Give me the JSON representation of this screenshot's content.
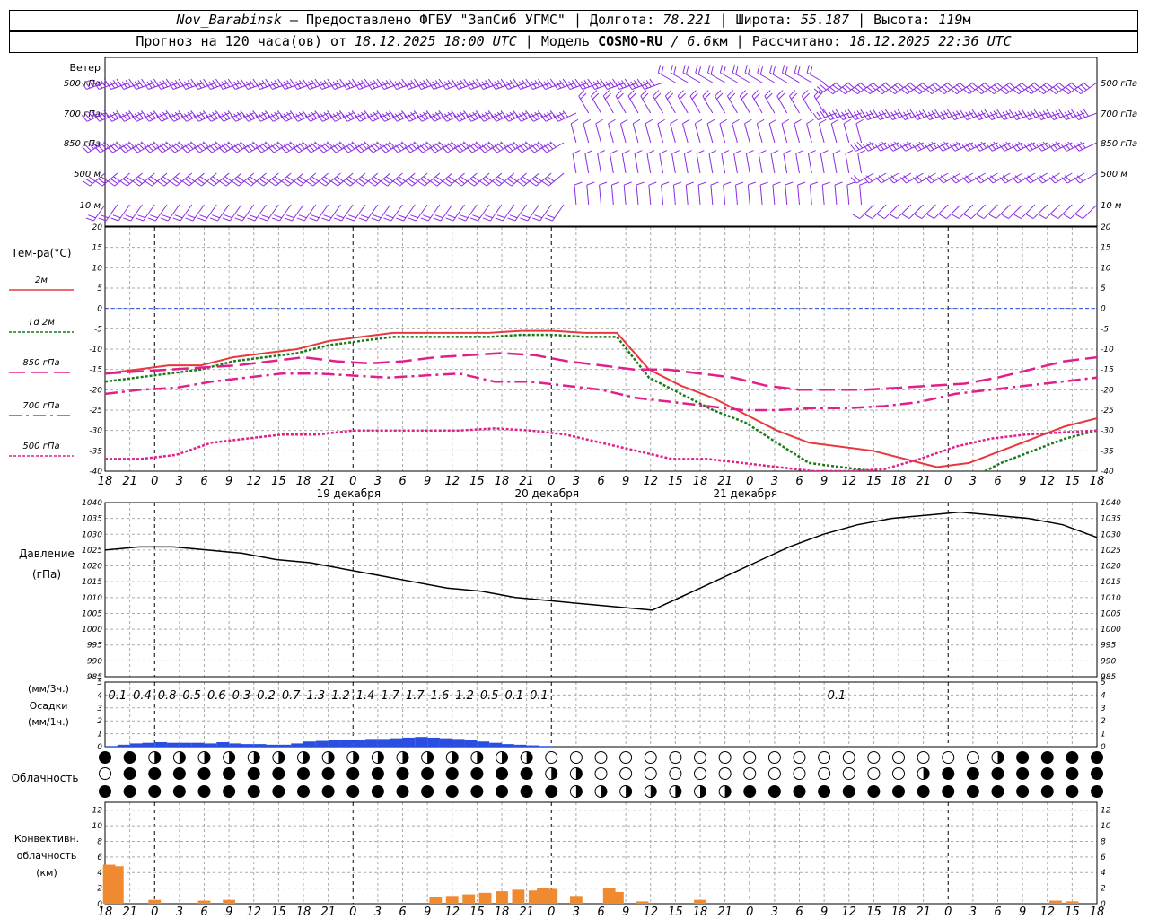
{
  "header": {
    "station": "Nov_Barabinsk",
    "provider": "— Предоставлено ФГБУ \"ЗапСиб УГМС\"",
    "lon_label": "Долгота:",
    "lon": "78.221",
    "lat_label": "Широта:",
    "lat": "55.187",
    "alt_label": "Высота:",
    "alt": "119",
    "alt_unit": "м",
    "forecast_label": "Прогноз на 120 часа(ов) от",
    "start_time": "18.12.2025 18:00 UTC",
    "model_label": "Модель",
    "model": "COSMO-RU",
    "model_res": "/ 6.6",
    "model_res_unit": "км",
    "calc_label": "Рассчитано:",
    "calc_time": "18.12.2025 22:36 UTC"
  },
  "chart_data": {
    "type": "line",
    "x_hours": [
      0,
      3,
      6,
      9,
      12,
      15,
      18,
      21,
      24,
      27,
      30,
      33,
      36,
      39,
      42,
      45,
      48,
      51,
      54,
      57,
      60,
      63,
      66,
      69,
      72,
      75,
      78,
      81,
      84,
      87,
      90,
      93,
      96,
      99,
      102,
      105,
      108,
      111,
      114,
      117,
      120
    ],
    "x_tick_labels": [
      "18",
      "21",
      "0",
      "3",
      "6",
      "9",
      "12",
      "15",
      "18",
      "21",
      "0",
      "3",
      "6",
      "9",
      "12",
      "15",
      "18",
      "21",
      "0",
      "3",
      "6",
      "9",
      "12",
      "15",
      "18",
      "21",
      "0",
      "3",
      "6",
      "9",
      "12",
      "15",
      "18",
      "21",
      "0",
      "3",
      "6",
      "9",
      "12",
      "15",
      "18",
      "21",
      "0"
    ],
    "day_labels": [
      {
        "hour": 30,
        "text": "19 декабря"
      },
      {
        "hour": 54,
        "text": "20 декабря"
      },
      {
        "hour": 78,
        "text": "21 декабря"
      }
    ],
    "day_boundaries": [
      6,
      30,
      54,
      78,
      102
    ],
    "wind": {
      "title": "Ветер",
      "levels": [
        "500 гПа",
        "700 гПа",
        "850 гПа",
        "500 м",
        "10 м"
      ],
      "color": "#8a2be2"
    },
    "temperature": {
      "title": "Тем-ра(°C)",
      "ylim": [
        -40,
        20
      ],
      "yticks": [
        20,
        15,
        10,
        5,
        0,
        -5,
        -10,
        -15,
        -20,
        -25,
        -30,
        -35,
        -40
      ],
      "legend": [
        {
          "label": "2м",
          "color": "#e8383d"
        },
        {
          "label": "Td  2м",
          "color": "#1a7a1a"
        },
        {
          "label": "850 гПа",
          "color": "#e0208a"
        },
        {
          "label": "700 гПа",
          "color": "#e0208a"
        },
        {
          "label": "500 гПа",
          "color": "#e0208a"
        }
      ],
      "series": [
        {
          "name": "2м",
          "color": "#e8383d",
          "style": "solid",
          "values": [
            -16,
            -15,
            -14,
            -14,
            -12,
            -11,
            -10,
            -8,
            -7,
            -6,
            -6,
            -6,
            -6,
            -5.5,
            -5.5,
            -6,
            -6,
            -15,
            -19,
            -22,
            -26,
            -30,
            -33,
            -34,
            -35,
            -37,
            -39,
            -38,
            -35,
            -32,
            -29,
            -27
          ]
        },
        {
          "name": "Td 2м",
          "color": "#1a7a1a",
          "style": "dotted",
          "values": [
            -18,
            -17,
            -16,
            -15,
            -13,
            -12,
            -11,
            -9,
            -8,
            -7,
            -7,
            -7,
            -7,
            -6.5,
            -6.5,
            -7,
            -7,
            -17,
            -21,
            -25,
            -28,
            -33,
            -38,
            -39,
            -40,
            -42,
            -45,
            -42,
            -38,
            -35,
            -32,
            -30
          ]
        },
        {
          "name": "850 гПа",
          "color": "#e0208a",
          "style": "longdash",
          "values": [
            -16,
            -15.5,
            -15,
            -14.5,
            -14,
            -13,
            -12,
            -13,
            -13.5,
            -13,
            -12,
            -11.5,
            -11,
            -11.5,
            -13,
            -14,
            -15,
            -15,
            -16,
            -17,
            -19,
            -20,
            -20,
            -20,
            -19.5,
            -19,
            -18.5,
            -17,
            -15,
            -13,
            -12
          ]
        },
        {
          "name": "700 гПа",
          "color": "#e0208a",
          "style": "dashdot",
          "values": [
            -21,
            -20,
            -19.5,
            -18,
            -17,
            -16,
            -16,
            -16.5,
            -17,
            -16.5,
            -16,
            -18,
            -18,
            -19,
            -20,
            -22,
            -23,
            -24,
            -25,
            -25,
            -24.5,
            -24.5,
            -24,
            -23,
            -21,
            -20,
            -19,
            -18,
            -17
          ]
        },
        {
          "name": "500 гПа",
          "color": "#e0208a",
          "style": "dotted",
          "values": [
            -37,
            -37,
            -36,
            -33,
            -32,
            -31,
            -31,
            -30,
            -30,
            -30,
            -30,
            -29.5,
            -30,
            -31,
            -33,
            -35,
            -37,
            -37,
            -38,
            -39,
            -40,
            -40,
            -39.5,
            -37,
            -34,
            -32,
            -31,
            -30.5,
            -30
          ]
        }
      ]
    },
    "pressure": {
      "title": "Давление",
      "unit": "(гПа)",
      "ylim": [
        985,
        1040
      ],
      "yticks": [
        1040,
        1035,
        1030,
        1025,
        1020,
        1015,
        1010,
        1005,
        1000,
        995,
        990,
        985
      ],
      "series": [
        {
          "name": "Давление",
          "color": "#000000",
          "values": [
            1025,
            1026,
            1026,
            1025,
            1024,
            1022,
            1021,
            1019,
            1017,
            1015,
            1013,
            1012,
            1010,
            1009,
            1008,
            1007,
            1006,
            1011,
            1016,
            1021,
            1026,
            1030,
            1033,
            1035,
            1036,
            1037,
            1036,
            1035,
            1033,
            1029
          ]
        }
      ]
    },
    "precipitation": {
      "label_top": "(мм/3ч.)",
      "label_mid": "Осадки",
      "label_bot": "(мм/1ч.)",
      "ylim": [
        0,
        5
      ],
      "yticks": [
        5,
        4,
        3,
        2,
        1,
        0
      ],
      "color": "#2a4fe0",
      "sum3h": [
        {
          "hour": 3,
          "text": "0.1"
        },
        {
          "hour": 6,
          "text": "0.4"
        },
        {
          "hour": 9,
          "text": "0.8"
        },
        {
          "hour": 12,
          "text": "0.5"
        },
        {
          "hour": 15,
          "text": "0.6"
        },
        {
          "hour": 18,
          "text": "0.3"
        },
        {
          "hour": 21,
          "text": "0.2"
        },
        {
          "hour": 24,
          "text": "0.7"
        },
        {
          "hour": 27,
          "text": "1.3"
        },
        {
          "hour": 30,
          "text": "1.2"
        },
        {
          "hour": 33,
          "text": "1.4"
        },
        {
          "hour": 36,
          "text": "1.7"
        },
        {
          "hour": 39,
          "text": "1.7"
        },
        {
          "hour": 42,
          "text": "1.6"
        },
        {
          "hour": 45,
          "text": "1.2"
        },
        {
          "hour": 48,
          "text": "0.5"
        },
        {
          "hour": 51,
          "text": "0.1"
        },
        {
          "hour": 54,
          "text": "0.1"
        },
        {
          "hour": 90,
          "text": "0.1"
        }
      ],
      "hourly": [
        0.05,
        0.15,
        0.25,
        0.3,
        0.35,
        0.3,
        0.3,
        0.3,
        0.25,
        0.35,
        0.25,
        0.2,
        0.2,
        0.15,
        0.15,
        0.25,
        0.4,
        0.45,
        0.5,
        0.55,
        0.55,
        0.6,
        0.6,
        0.65,
        0.7,
        0.75,
        0.7,
        0.65,
        0.6,
        0.5,
        0.4,
        0.3,
        0.2,
        0.15,
        0.1,
        0.05
      ]
    },
    "cloud": {
      "title": "Облачность",
      "rows": 3,
      "columns": 40
    },
    "convective": {
      "title_1": "Конвективн.",
      "title_2": "облачность",
      "title_3": "(км)",
      "ylim": [
        0,
        13
      ],
      "yticks": [
        12,
        10,
        8,
        6,
        4,
        2,
        0
      ],
      "color": "#f08a30",
      "bars": [
        {
          "hour": 0.5,
          "value": 5
        },
        {
          "hour": 1.5,
          "value": 4.8
        },
        {
          "hour": 6,
          "value": 0.5
        },
        {
          "hour": 12,
          "value": 0.4
        },
        {
          "hour": 15,
          "value": 0.5
        },
        {
          "hour": 40,
          "value": 0.8
        },
        {
          "hour": 42,
          "value": 1
        },
        {
          "hour": 44,
          "value": 1.2
        },
        {
          "hour": 46,
          "value": 1.4
        },
        {
          "hour": 48,
          "value": 1.6
        },
        {
          "hour": 50,
          "value": 1.8
        },
        {
          "hour": 52,
          "value": 1.7
        },
        {
          "hour": 53,
          "value": 2
        },
        {
          "hour": 54,
          "value": 1.9
        },
        {
          "hour": 57,
          "value": 1
        },
        {
          "hour": 61,
          "value": 2
        },
        {
          "hour": 62,
          "value": 1.5
        },
        {
          "hour": 65,
          "value": 0.3
        },
        {
          "hour": 72,
          "value": 0.5
        },
        {
          "hour": 115,
          "value": 0.4
        },
        {
          "hour": 117,
          "value": 0.3
        }
      ]
    }
  }
}
